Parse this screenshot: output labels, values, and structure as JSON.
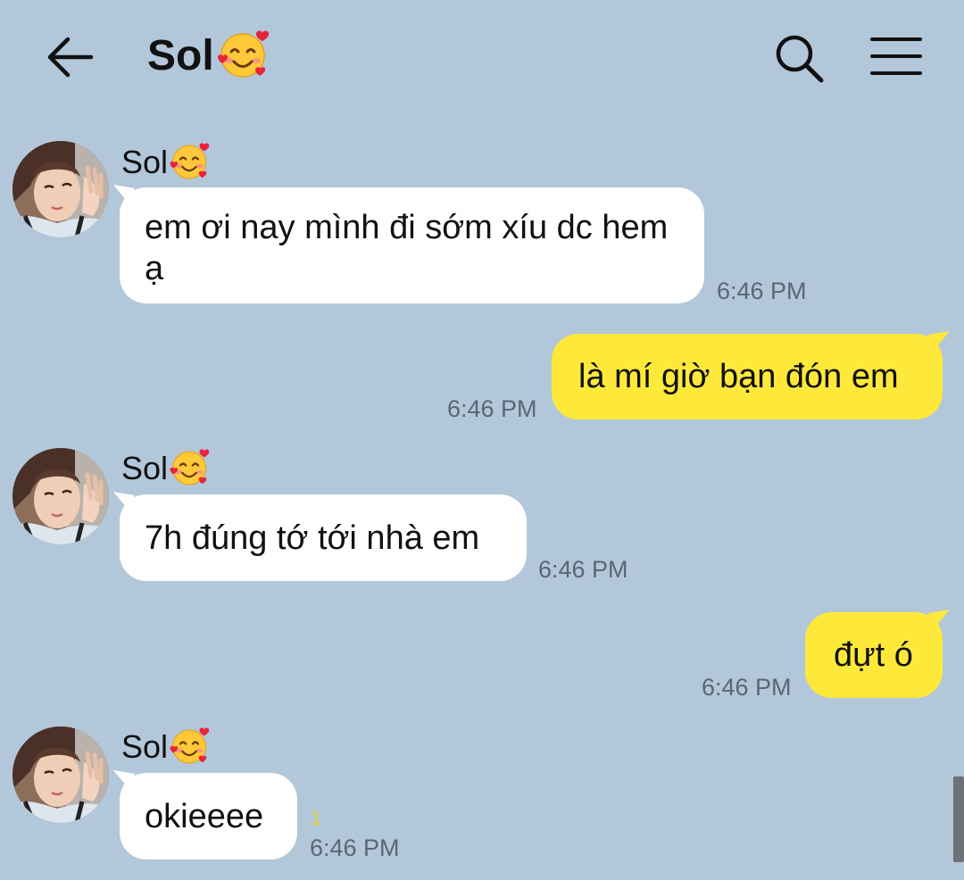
{
  "header": {
    "title": "Sol",
    "title_emoji": "smiling-face-with-hearts-emoji"
  },
  "icons": {
    "back": "arrow-left-icon",
    "search": "search-icon",
    "menu": "hamburger-menu-icon"
  },
  "colors": {
    "background": "#b2c7da",
    "incoming_bubble": "#ffffff",
    "outgoing_bubble": "#fee93a",
    "timestamp": "#5b6773",
    "unread": "#e3d02c"
  },
  "messages": [
    {
      "direction": "in",
      "sender": "Sol",
      "text": "em ơi nay mình đi sớm xíu dc hem ạ",
      "time": "6:46 PM"
    },
    {
      "direction": "out",
      "text": "là mí giờ bạn đón em",
      "time": "6:46 PM"
    },
    {
      "direction": "in",
      "sender": "Sol",
      "text": "7h đúng tớ tới nhà em",
      "time": "6:46 PM"
    },
    {
      "direction": "out",
      "text": "đựt ó",
      "time": "6:46 PM"
    },
    {
      "direction": "in",
      "sender": "Sol",
      "text": "okieeee",
      "time": "6:46 PM",
      "unread_count": "1"
    }
  ]
}
